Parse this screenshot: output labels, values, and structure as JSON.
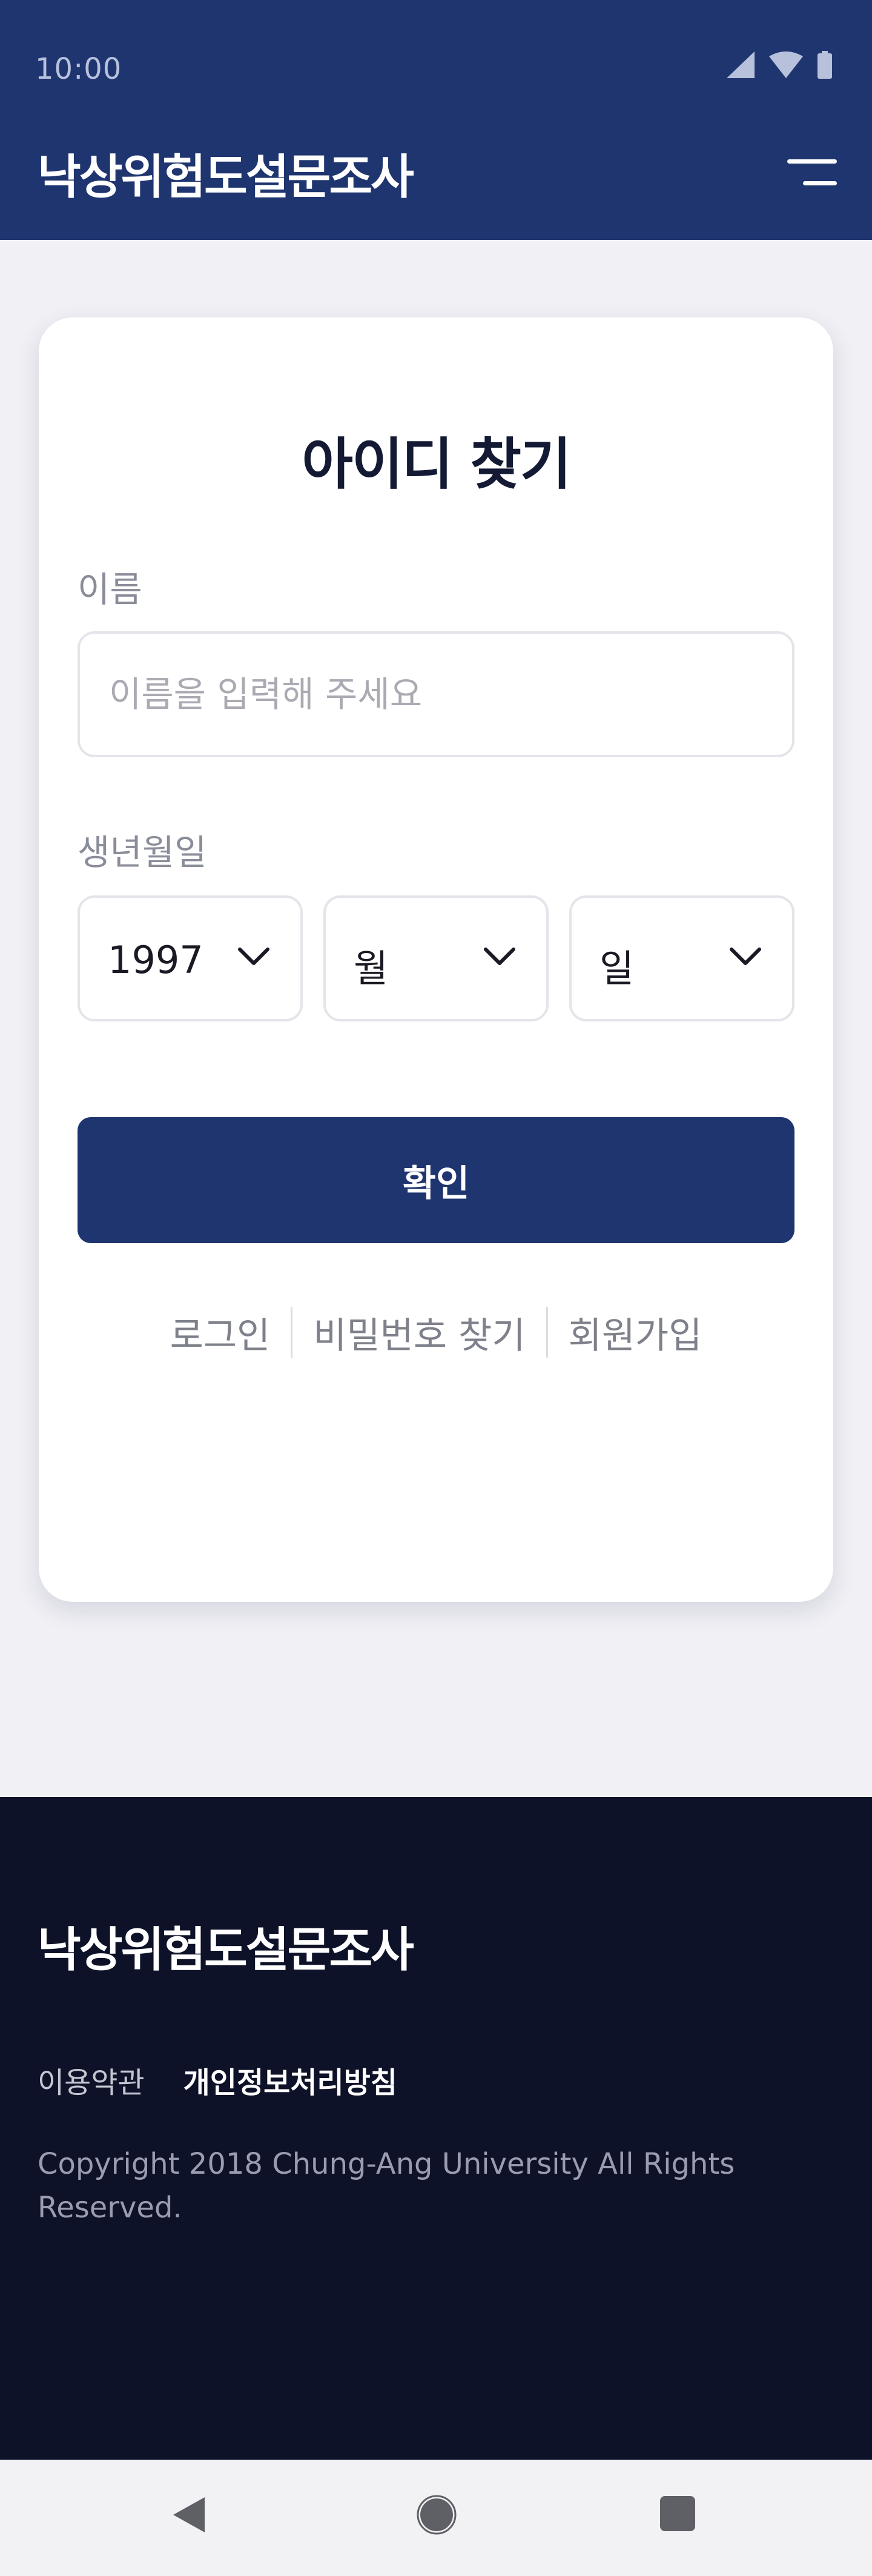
{
  "status_bar": {
    "time": "10:00",
    "icons": [
      "signal-icon",
      "wifi-icon",
      "battery-icon"
    ]
  },
  "header": {
    "title": "낙상위험도설문조사",
    "menu_icon": "hamburger-menu-icon"
  },
  "card": {
    "title": "아이디 찾기",
    "name_label": "이름",
    "name_placeholder": "이름을 입력해 주세요",
    "name_value": "",
    "birth_label": "생년월일",
    "year_value": "1997",
    "month_value": "월",
    "day_value": "일",
    "confirm_label": "확인",
    "links": [
      "로그인",
      "비밀번호 찾기",
      "회원가입"
    ]
  },
  "footer": {
    "title": "낙상위험도설문조사",
    "links": [
      "이용약관",
      "개인정보처리방침"
    ],
    "copyright": "Copyright 2018 Chung-Ang University All Rights Reserved."
  },
  "nav_bar": {
    "icons": [
      "back-icon",
      "home-icon",
      "recents-icon"
    ]
  },
  "colors": {
    "brand_primary": "#1f3570",
    "footer_background": "#0e1228",
    "page_background": "#f0f0f5"
  }
}
